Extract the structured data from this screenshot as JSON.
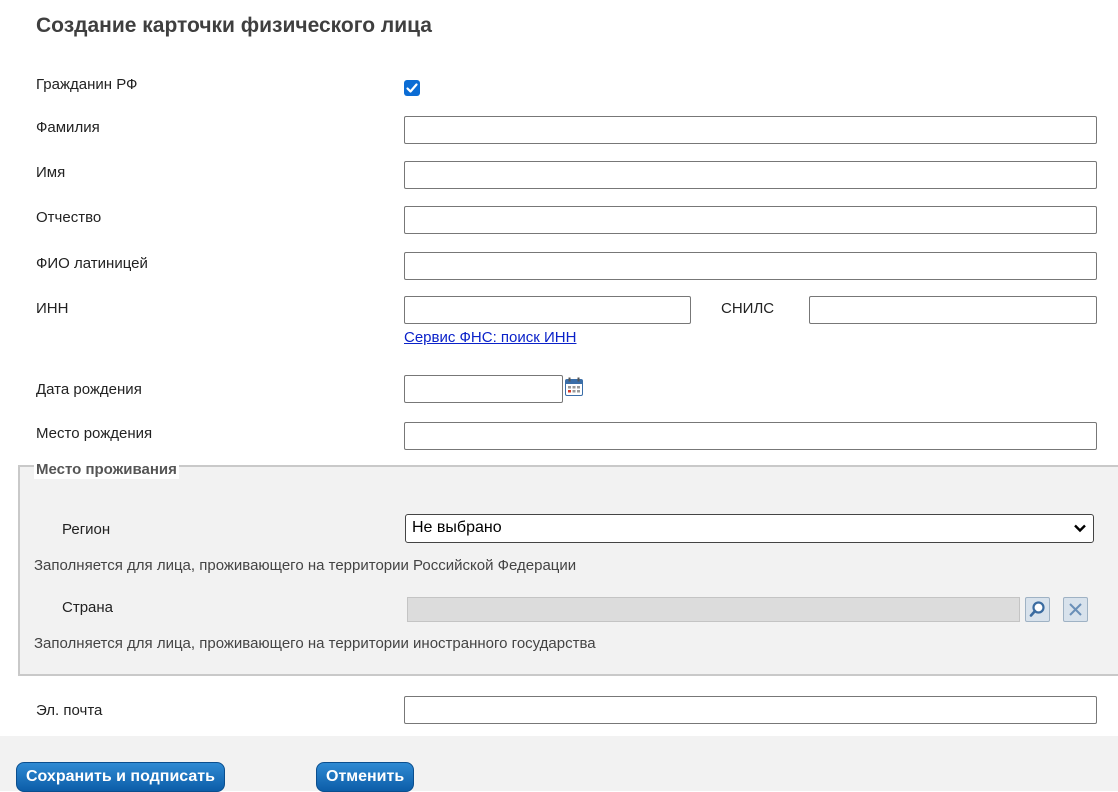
{
  "page": {
    "title": "Создание карточки физического лица"
  },
  "form": {
    "citizen_label": "Гражданин РФ",
    "citizen_checked": true,
    "lastname_label": "Фамилия",
    "lastname_value": "",
    "firstname_label": "Имя",
    "firstname_value": "",
    "patronymic_label": "Отчество",
    "patronymic_value": "",
    "latin_label": "ФИО латиницей",
    "latin_value": "",
    "inn_label": "ИНН",
    "inn_value": "",
    "snils_label": "СНИЛС",
    "snils_value": "",
    "inn_service_link": "Сервис ФНС: поиск ИНН",
    "birthdate_label": "Дата рождения",
    "birthdate_value": "",
    "birthplace_label": "Место рождения",
    "birthplace_value": "",
    "email_label": "Эл. почта",
    "email_value": ""
  },
  "residence": {
    "legend": "Место проживания",
    "region_label": "Регион",
    "region_selected": "Не выбрано",
    "region_hint": "Заполняется для лица, проживающего на территории Российской Федерации",
    "country_label": "Страна",
    "country_value": "",
    "country_hint": "Заполняется для лица, проживающего на территории иностранного государства"
  },
  "actions": {
    "save_sign_label": "Сохранить и подписать",
    "cancel_label": "Отменить"
  },
  "colors": {
    "accent": "#0b6cd4",
    "link": "#0b22c9",
    "button": "#1a73bd"
  }
}
